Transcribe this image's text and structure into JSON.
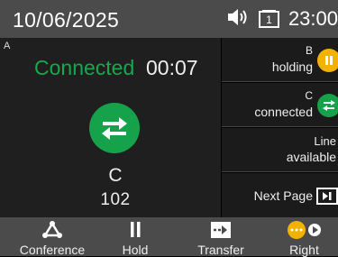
{
  "status_bar": {
    "date": "10/06/2025",
    "time": "23:00",
    "icons": [
      "speaker-volume-icon",
      "line-one-icon"
    ],
    "line_indicator": "1"
  },
  "active_call": {
    "line_letter": "A",
    "status": "Connected",
    "timer": "00:07",
    "icon": "call-transfer-arrows-icon",
    "caller_name": "C",
    "caller_number": "102",
    "accent_color": "#16a24a"
  },
  "side_lines": [
    {
      "letter": "B",
      "status": "holding",
      "icon": "pause-icon",
      "color": "#f2b300"
    },
    {
      "letter": "C",
      "status": "connected",
      "icon": "call-transfer-arrows-icon",
      "color": "#16a24a"
    },
    {
      "letter": "Line",
      "status": "available"
    },
    {
      "label": "Next Page",
      "icon": "next-page-icon"
    }
  ],
  "softkeys": [
    {
      "label": "Conference",
      "icon": "conference-icon"
    },
    {
      "label": "Hold",
      "icon": "pause-icon"
    },
    {
      "label": "Transfer",
      "icon": "transfer-icon"
    },
    {
      "label": "Right",
      "icon": "more-dots-icon"
    }
  ],
  "colors": {
    "status_bar_bg": "#4b4b4b",
    "panel_bg": "#1f1f1f",
    "connected_green": "#16a24a",
    "holding_yellow": "#f2b300"
  }
}
